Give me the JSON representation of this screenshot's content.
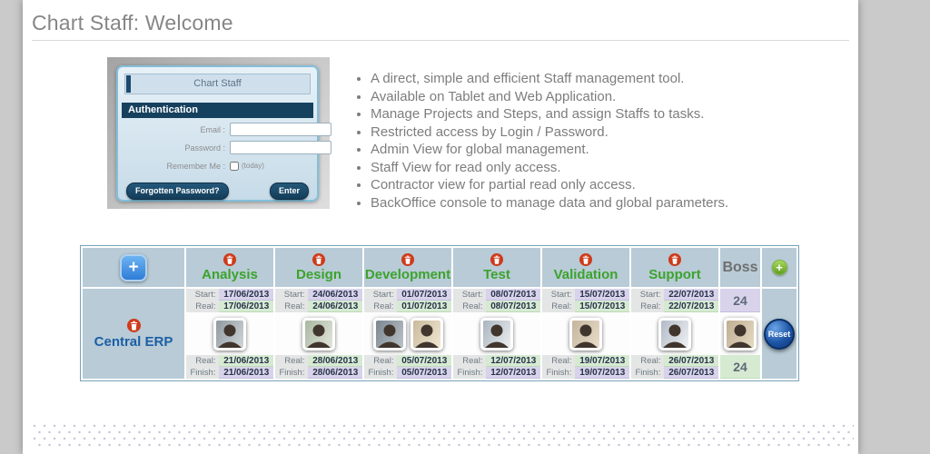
{
  "window": {
    "title": "Chart Staff: Welcome"
  },
  "login_panel": {
    "app_title": "Chart Staff",
    "section_title": "Authentication",
    "email_label": "Email :",
    "email_value": "",
    "password_label": "Password :",
    "password_value": "",
    "remember_label": "Remember Me :",
    "remember_hint": "(today)",
    "forgot_button": "Forgotten Password?",
    "enter_button": "Enter"
  },
  "features": {
    "items": [
      "A direct, simple and efficient Staff management tool.",
      "Available on Tablet and Web Application.",
      "Manage Projects and Steps, and assign Staffs to tasks.",
      "Restricted access by Login / Password.",
      "Admin View for global management.",
      "Staff View for read only access.",
      "Contractor view for partial read only access.",
      "BackOffice console to manage data and global parameters."
    ]
  },
  "chart": {
    "labels": {
      "start": "Start:",
      "real": "Real:",
      "finish": "Finish:"
    },
    "project": {
      "name": "Central ERP"
    },
    "boss": {
      "header": "Boss",
      "top_value": "24",
      "bottom_value": "24"
    },
    "reset_label": "Reset",
    "steps": [
      {
        "name": "Analysis",
        "start": "17/06/2013",
        "real_start": "17/06/2013",
        "real_finish": "21/06/2013",
        "finish": "21/06/2013",
        "staff_count": 1
      },
      {
        "name": "Design",
        "start": "24/06/2013",
        "real_start": "24/06/2013",
        "real_finish": "28/06/2013",
        "finish": "28/06/2013",
        "staff_count": 1
      },
      {
        "name": "Development",
        "start": "01/07/2013",
        "real_start": "01/07/2013",
        "real_finish": "05/07/2013",
        "finish": "05/07/2013",
        "staff_count": 2
      },
      {
        "name": "Test",
        "start": "08/07/2013",
        "real_start": "08/07/2013",
        "real_finish": "12/07/2013",
        "finish": "12/07/2013",
        "staff_count": 1
      },
      {
        "name": "Validation",
        "start": "15/07/2013",
        "real_start": "15/07/2013",
        "real_finish": "19/07/2013",
        "finish": "19/07/2013",
        "staff_count": 1
      },
      {
        "name": "Support",
        "start": "22/07/2013",
        "real_start": "22/07/2013",
        "real_finish": "26/07/2013",
        "finish": "26/07/2013",
        "staff_count": 1
      }
    ]
  },
  "icons": {
    "add_project": "+",
    "add_step": "+",
    "delete": "trash-can"
  },
  "colors": {
    "accent_green": "#3ca32c",
    "project_navy": "#1b5fa5",
    "cell_blue": "#b8cbd6",
    "lavender": "#d8d3eb",
    "cell_green": "#d6ead2",
    "button_navy": "#16415e",
    "delete_red": "#cf3a1a"
  }
}
